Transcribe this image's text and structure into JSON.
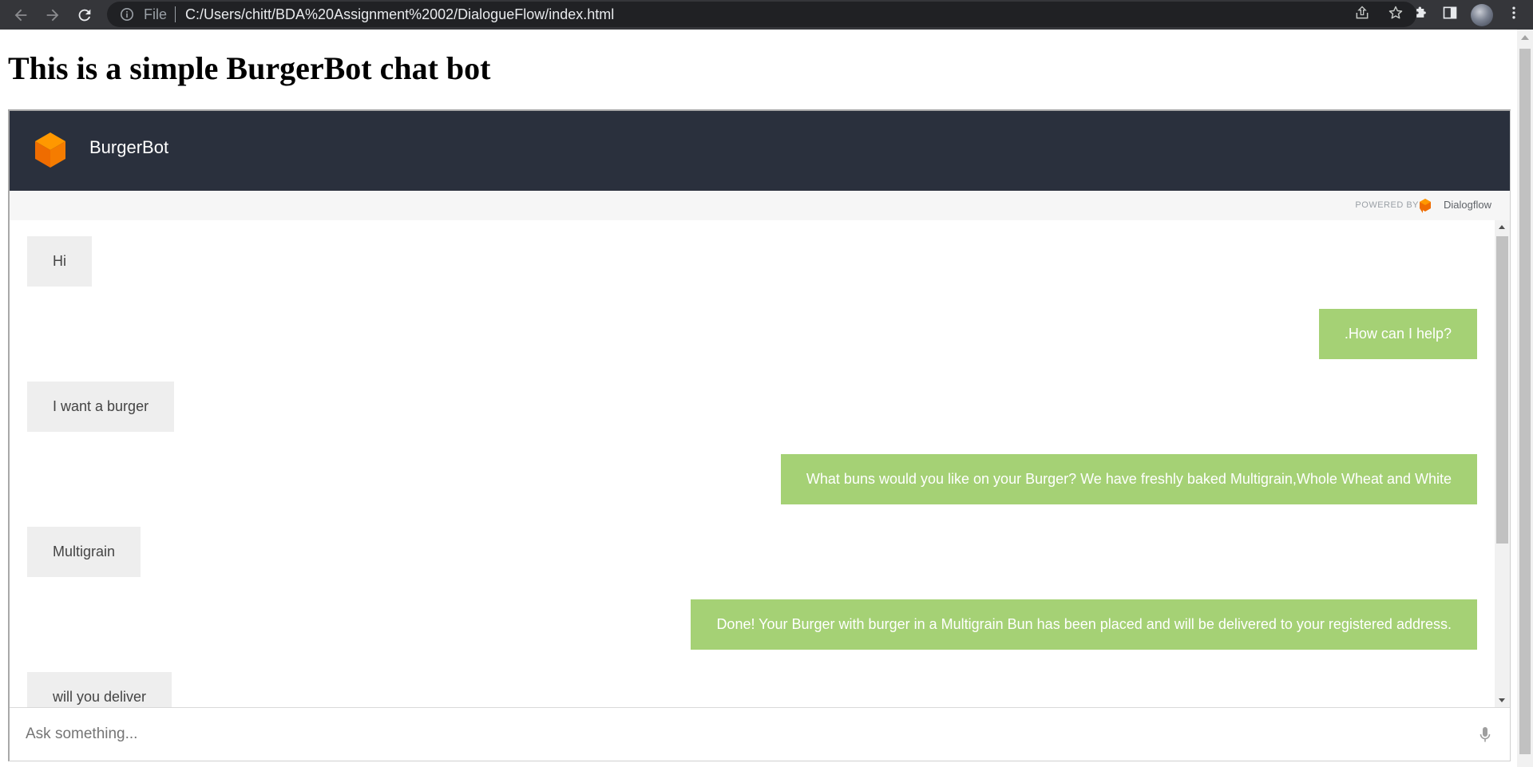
{
  "browser": {
    "url_scheme_label": "File",
    "url": "C:/Users/chitt/BDA%20Assignment%2002/DialogueFlow/index.html"
  },
  "page": {
    "title": "This is a simple BurgerBot chat bot"
  },
  "chat": {
    "bot_name": "BurgerBot",
    "powered_by": "POWERED BY",
    "provider_name": "Dialogflow",
    "input_placeholder": "Ask something...",
    "messages": [
      {
        "from": "user",
        "text": "Hi"
      },
      {
        "from": "bot",
        "text": ".How can I help?"
      },
      {
        "from": "user",
        "text": "I want a burger"
      },
      {
        "from": "bot",
        "text": "What buns would you like on your Burger? We have freshly baked Multigrain,Whole Wheat and White"
      },
      {
        "from": "user",
        "text": "Multigrain"
      },
      {
        "from": "bot",
        "text": "Done! Your Burger with burger in a Multigrain Bun has been placed and will be delivered to your registered address."
      },
      {
        "from": "user",
        "text": "will you deliver"
      }
    ]
  },
  "colors": {
    "header_bg": "#2a303d",
    "bot_bubble": "#a5d175",
    "user_bubble": "#eeeeee",
    "logo_orange": "#ef6c00"
  },
  "icons": {
    "back": "arrow-left-icon",
    "forward": "arrow-right-icon",
    "reload": "reload-icon",
    "info": "info-icon",
    "share": "share-icon",
    "bookmark": "star-icon",
    "extensions": "puzzle-icon",
    "side_panel": "side-panel-icon",
    "menu": "kebab-menu-icon",
    "mic": "microphone-icon"
  }
}
